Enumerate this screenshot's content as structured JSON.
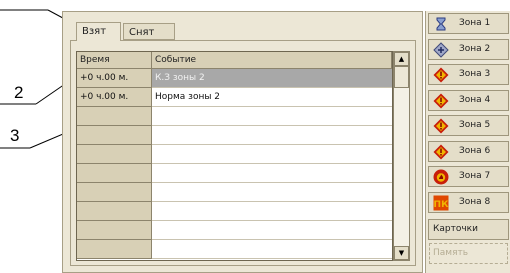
{
  "tabs": [
    {
      "label": "Взят",
      "active": true
    },
    {
      "label": "Снят",
      "active": false
    }
  ],
  "grid": {
    "headers": {
      "time": "Время",
      "event": "Событие"
    },
    "rows": [
      {
        "time": "+0 ч.00 м.",
        "event": "К.З зоны 2",
        "selected": true
      },
      {
        "time": "+0 ч.00 м.",
        "event": "Норма зоны 2",
        "selected": false
      },
      {
        "time": "",
        "event": ""
      },
      {
        "time": "",
        "event": ""
      },
      {
        "time": "",
        "event": ""
      },
      {
        "time": "",
        "event": ""
      },
      {
        "time": "",
        "event": ""
      },
      {
        "time": "",
        "event": ""
      },
      {
        "time": "",
        "event": ""
      },
      {
        "time": "",
        "event": ""
      }
    ]
  },
  "zones": [
    {
      "label": "Зона 1",
      "icon": "hourglass-icon"
    },
    {
      "label": "Зона 2",
      "icon": "diamond-arrows-icon"
    },
    {
      "label": "Зона 3",
      "icon": "alarm-icon"
    },
    {
      "label": "Зона 4",
      "icon": "alarm-icon"
    },
    {
      "label": "Зона 5",
      "icon": "alarm-icon"
    },
    {
      "label": "Зона 6",
      "icon": "alarm-icon"
    },
    {
      "label": "Зона 7",
      "icon": "fire-icon"
    },
    {
      "label": "Зона 8",
      "icon": "pk-icon"
    }
  ],
  "cards_label": "Карточки",
  "memory_label": "Память",
  "callouts": [
    "2",
    "3"
  ],
  "colors": {
    "alarm": "#c81e0a",
    "warning_fill": "#f0b400",
    "selection": "#a8a8a8"
  }
}
